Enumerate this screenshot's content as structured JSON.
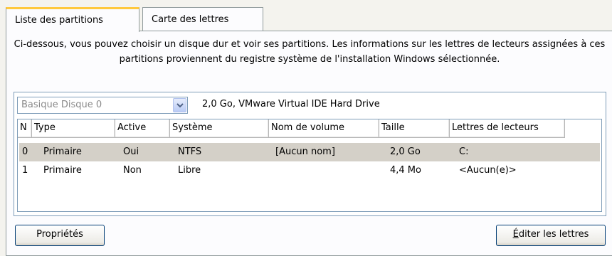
{
  "tabs": [
    {
      "label": "Liste des partitions",
      "active": true
    },
    {
      "label": "Carte des lettres",
      "active": false
    }
  ],
  "description": "Ci-dessous, vous pouvez choisir un disque dur et voir ses partitions. Les informations sur les lettres de lecteurs assignées à ces partitions proviennent du registre système de l'installation Windows sélectionnée.",
  "disk_select": {
    "value": "Basique Disque 0"
  },
  "disk_info": "2,0 Go, VMware Virtual IDE Hard Drive",
  "columns": [
    "N",
    "Type",
    "Active",
    "Système",
    "Nom de volume",
    "Taille",
    "Lettres de lecteurs"
  ],
  "rows": [
    {
      "n": "0",
      "type": "Primaire",
      "active": "Oui",
      "system": "NTFS",
      "volume": "[Aucun nom]",
      "size": "2,0 Go",
      "letters": "C:",
      "selected": true
    },
    {
      "n": "1",
      "type": "Primaire",
      "active": "Non",
      "system": "Libre",
      "volume": "",
      "size": "4,4 Mo",
      "letters": "<Aucun(e)>",
      "selected": false
    }
  ],
  "buttons": {
    "properties": "Propriétés",
    "edit_letters_mnemonic": "É",
    "edit_letters_rest": "diter les lettres"
  },
  "colors": {
    "active_tab_accent": "#ffc83c",
    "selection": "#d4d0c8",
    "border": "#7f9db9"
  }
}
